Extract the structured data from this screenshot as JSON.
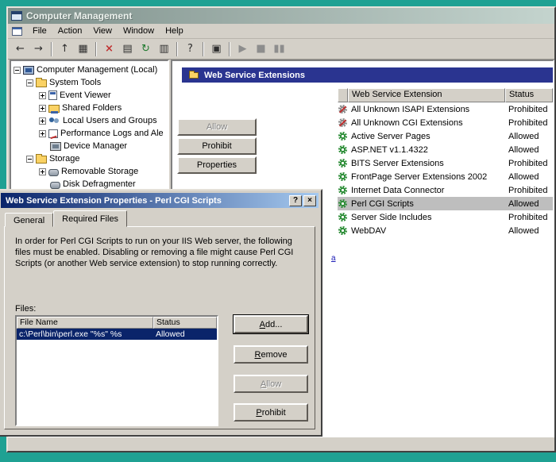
{
  "colors": {
    "desktop": "#1FA193",
    "taskpad_header": "#2A3490",
    "active_title_start": "#0A246A",
    "active_title_end": "#A6CAF0",
    "chrome": "#D4D0C8",
    "inactive_selection": "#BEBEBE"
  },
  "main_window": {
    "title": "Computer Management",
    "menu": [
      {
        "label": "File"
      },
      {
        "label": "Action"
      },
      {
        "label": "View"
      },
      {
        "label": "Window"
      },
      {
        "label": "Help"
      }
    ],
    "toolbar": [
      {
        "name": "back-icon",
        "glyph": "←"
      },
      {
        "name": "forward-icon",
        "glyph": "→"
      },
      {
        "name": "up-icon",
        "glyph": "↑"
      },
      {
        "name": "show-hide-console-tree-icon",
        "glyph": "▦"
      },
      {
        "name": "delete-icon",
        "glyph": "×"
      },
      {
        "name": "properties-icon",
        "glyph": "▤"
      },
      {
        "name": "refresh-icon",
        "glyph": "↻"
      },
      {
        "name": "export-list-icon",
        "glyph": "▥"
      },
      {
        "name": "help-icon",
        "glyph": "?"
      },
      {
        "name": "window-icon",
        "glyph": "▣"
      },
      {
        "name": "start-icon",
        "glyph": "▶"
      },
      {
        "name": "stop-icon",
        "glyph": "■"
      },
      {
        "name": "pause-icon",
        "glyph": "▮▮"
      }
    ]
  },
  "tree": {
    "items": [
      {
        "label": "Computer Management (Local)",
        "icon": "computer-icon"
      },
      {
        "label": "System Tools",
        "icon": "folder-icon"
      },
      {
        "label": "Event Viewer",
        "icon": "event-viewer-icon"
      },
      {
        "label": "Shared Folders",
        "icon": "shared-folders-icon"
      },
      {
        "label": "Local Users and Groups",
        "icon": "users-icon"
      },
      {
        "label": "Performance Logs and Ale",
        "icon": "performance-icon"
      },
      {
        "label": "Device Manager",
        "icon": "device-manager-icon"
      },
      {
        "label": "Storage",
        "icon": "folder-icon"
      },
      {
        "label": "Removable Storage",
        "icon": "removable-storage-icon"
      },
      {
        "label": "Disk Defragmenter",
        "icon": "disk-icon"
      }
    ]
  },
  "taskpad": {
    "title": "Web Service Extensions"
  },
  "actions": [
    {
      "label": "Allow",
      "disabled": true
    },
    {
      "label": "Prohibit"
    },
    {
      "label": "Properties"
    }
  ],
  "extensions": {
    "columns": [
      "Web Service Extension",
      "Status"
    ],
    "rows": [
      {
        "name": "All Unknown ISAPI Extensions",
        "status": "Prohibited",
        "icon": "gear-gray"
      },
      {
        "name": "All Unknown CGI Extensions",
        "status": "Prohibited",
        "icon": "gear-gray"
      },
      {
        "name": "Active Server Pages",
        "status": "Allowed",
        "icon": "gear-green"
      },
      {
        "name": "ASP.NET v1.1.4322",
        "status": "Allowed",
        "icon": "gear-green"
      },
      {
        "name": "BITS Server Extensions",
        "status": "Prohibited",
        "icon": "gear-green"
      },
      {
        "name": "FrontPage Server Extensions 2002",
        "status": "Allowed",
        "icon": "gear-green"
      },
      {
        "name": "Internet Data Connector",
        "status": "Prohibited",
        "icon": "gear-green"
      },
      {
        "name": "Perl CGI Scripts",
        "status": "Allowed",
        "icon": "gear-green",
        "selected": true
      },
      {
        "name": "Server Side Includes",
        "status": "Prohibited",
        "icon": "gear-green"
      },
      {
        "name": "WebDAV",
        "status": "Allowed",
        "icon": "gear-green"
      }
    ]
  },
  "link_fragment": {
    "text": "a"
  },
  "dialog": {
    "title": "Web Service Extension Properties - Perl CGI Scripts",
    "help_glyph": "?",
    "close_glyph": "×",
    "tabs": [
      {
        "label": "General"
      },
      {
        "label": "Required Files",
        "active": true
      }
    ],
    "description": "In order for Perl CGI Scripts to run on your IIS Web server, the following files must be enabled.  Disabling or removing a file might cause Perl CGI Scripts (or another Web service extension) to stop running correctly.",
    "files_label": "Files:",
    "files": {
      "columns": [
        "File Name",
        "Status"
      ],
      "rows": [
        {
          "name": "c:\\Perl\\bin\\perl.exe \"%s\" %s",
          "status": "Allowed",
          "selected": true
        }
      ]
    },
    "buttons": [
      {
        "label": "Add...",
        "default": true
      },
      {
        "label": "Remove"
      },
      {
        "label": "Allow",
        "disabled": true
      },
      {
        "label": "Prohibit"
      }
    ]
  }
}
